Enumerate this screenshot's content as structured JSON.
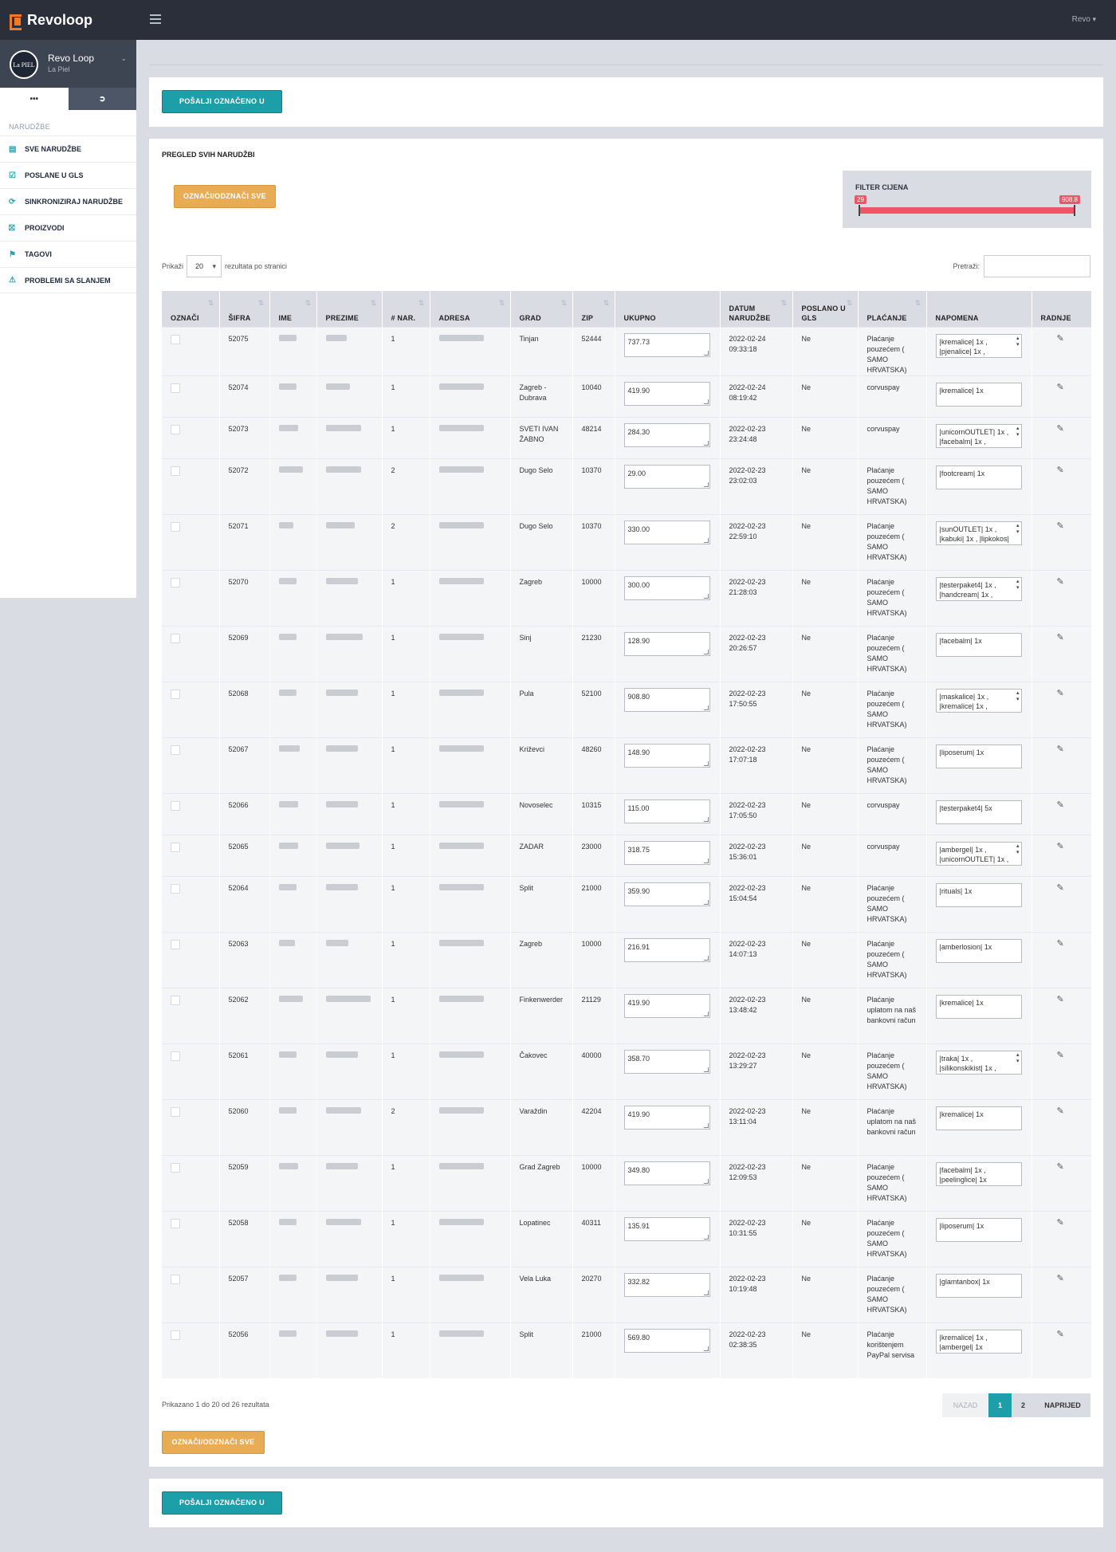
{
  "app": {
    "brand": "Revoloop",
    "user_menu": "Revo"
  },
  "profile": {
    "name": "Revo Loop",
    "subtitle": "La Piel",
    "avatar_text": "La PIEL",
    "tab_more": "•••",
    "tab_logout_icon": "logout-icon"
  },
  "nav": {
    "header": "NARUDŽBE",
    "items": [
      {
        "label": "SVE NARUDŽBE",
        "icon": "list-icon"
      },
      {
        "label": "POSLANE U GLS",
        "icon": "check-square-icon"
      },
      {
        "label": "SINKRONIZIRAJ NARUDŽBE",
        "icon": "sync-icon"
      },
      {
        "label": "PROIZVODI",
        "icon": "cart-icon"
      },
      {
        "label": "TAGOVI",
        "icon": "bookmark-icon"
      },
      {
        "label": "PROBLEMI SA SLANJEM",
        "icon": "warning-icon"
      }
    ]
  },
  "actions": {
    "send_gls": "POŠALJI OZNAČENO U GLS",
    "toggle_all": "OZNAČI/ODZNAČI SVE"
  },
  "orders_panel": {
    "title": "PREGLED SVIH NARUDŽBI",
    "filter_label": "FILTER CIJENA",
    "filter_min": "29",
    "filter_max": "908.8",
    "show_label_before": "Prikaži",
    "page_size": "20",
    "show_label_after": "rezultata po stranici",
    "search_label": "Pretraži:",
    "search_value": "",
    "columns": [
      "OZNAČI",
      "ŠIFRA",
      "IME",
      "PREZIME",
      "# NAR.",
      "ADRESA",
      "GRAD",
      "ZIP",
      "UKUPNO",
      "DATUM NARUDŽBE",
      "POSLANO U GLS",
      "PLAĆANJE",
      "NAPOMENA",
      "RADNJE"
    ],
    "rows": [
      {
        "sifra": "52075",
        "nar": "1",
        "grad": "Tinjan",
        "zip": "52444",
        "ukupno": "737.73",
        "datum": "2022-02-24 09:33:18",
        "poslano": "Ne",
        "placanje": "Plaćanje pouzećem ( SAMO HRVATSKA)",
        "napomena": "|kremalice| 1x ,\n|pjenalice| 1x ,",
        "scroll": true,
        "h": 56
      },
      {
        "sifra": "52074",
        "nar": "1",
        "grad": "Zagreb - Dubrava",
        "zip": "10040",
        "ukupno": "419.90",
        "datum": "2022-02-24 08:19:42",
        "poslano": "Ne",
        "placanje": "corvuspay",
        "napomena": "|kremalice| 1x",
        "scroll": false,
        "h": 52
      },
      {
        "sifra": "52073",
        "nar": "1",
        "grad": "SVETI IVAN ŽABNO",
        "zip": "48214",
        "ukupno": "284.30",
        "datum": "2022-02-23 23:24:48",
        "poslano": "Ne",
        "placanje": "corvuspay",
        "napomena": "|unicornOUTLET| 1x ,\n|facebalm| 1x ,",
        "scroll": true,
        "h": 52
      },
      {
        "sifra": "52072",
        "nar": "2",
        "grad": "Dugo Selo",
        "zip": "10370",
        "ukupno": "29.00",
        "datum": "2022-02-23 23:02:03",
        "poslano": "Ne",
        "placanje": "Plaćanje pouzećem ( SAMO HRVATSKA)",
        "napomena": "|footcream| 1x",
        "scroll": false,
        "h": 70
      },
      {
        "sifra": "52071",
        "nar": "2",
        "grad": "Dugo Selo",
        "zip": "10370",
        "ukupno": "330.00",
        "datum": "2022-02-23 22:59:10",
        "poslano": "Ne",
        "placanje": "Plaćanje pouzećem ( SAMO HRVATSKA)",
        "napomena": "|sunOUTLET| 1x ,\n|kabuki| 1x , |lipkokos|",
        "scroll": true,
        "h": 70
      },
      {
        "sifra": "52070",
        "nar": "1",
        "grad": "Zagreb",
        "zip": "10000",
        "ukupno": "300.00",
        "datum": "2022-02-23 21:28:03",
        "poslano": "Ne",
        "placanje": "Plaćanje pouzećem ( SAMO HRVATSKA)",
        "napomena": "|testerpaket4| 1x ,\n|handcream| 1x ,",
        "scroll": true,
        "h": 70
      },
      {
        "sifra": "52069",
        "nar": "1",
        "grad": "Sinj",
        "zip": "21230",
        "ukupno": "128.90",
        "datum": "2022-02-23 20:26:57",
        "poslano": "Ne",
        "placanje": "Plaćanje pouzećem ( SAMO HRVATSKA)",
        "napomena": "|facebalm| 1x",
        "scroll": false,
        "h": 70
      },
      {
        "sifra": "52068",
        "nar": "1",
        "grad": "Pula",
        "zip": "52100",
        "ukupno": "908.80",
        "datum": "2022-02-23 17:50:55",
        "poslano": "Ne",
        "placanje": "Plaćanje pouzećem ( SAMO HRVATSKA)",
        "napomena": "|maskalice| 1x ,\n|kremalice| 1x ,",
        "scroll": true,
        "h": 70
      },
      {
        "sifra": "52067",
        "nar": "1",
        "grad": "Križevci",
        "zip": "48260",
        "ukupno": "148.90",
        "datum": "2022-02-23 17:07:18",
        "poslano": "Ne",
        "placanje": "Plaćanje pouzećem ( SAMO HRVATSKA)",
        "napomena": "|liposerum| 1x",
        "scroll": false,
        "h": 70
      },
      {
        "sifra": "52066",
        "nar": "1",
        "grad": "Novoselec",
        "zip": "10315",
        "ukupno": "115.00",
        "datum": "2022-02-23 17:05:50",
        "poslano": "Ne",
        "placanje": "corvuspay",
        "napomena": "|testerpaket4| 5x",
        "scroll": false,
        "h": 52
      },
      {
        "sifra": "52065",
        "nar": "1",
        "grad": "ZADAR",
        "zip": "23000",
        "ukupno": "318.75",
        "datum": "2022-02-23 15:36:01",
        "poslano": "Ne",
        "placanje": "corvuspay",
        "napomena": "|ambergel| 1x ,\n|unicornOUTLET| 1x ,",
        "scroll": true,
        "h": 52
      },
      {
        "sifra": "52064",
        "nar": "1",
        "grad": "Split",
        "zip": "21000",
        "ukupno": "359.90",
        "datum": "2022-02-23 15:04:54",
        "poslano": "Ne",
        "placanje": "Plaćanje pouzećem ( SAMO HRVATSKA)",
        "napomena": "|rituals| 1x",
        "scroll": false,
        "h": 70
      },
      {
        "sifra": "52063",
        "nar": "1",
        "grad": "Zagreb",
        "zip": "10000",
        "ukupno": "216.91",
        "datum": "2022-02-23 14:07:13",
        "poslano": "Ne",
        "placanje": "Plaćanje pouzećem ( SAMO HRVATSKA)",
        "napomena": "|amberlosion| 1x",
        "scroll": false,
        "h": 70
      },
      {
        "sifra": "52062",
        "nar": "1",
        "grad": "Finkenwerder",
        "zip": "21129",
        "ukupno": "419.90",
        "datum": "2022-02-23 13:48:42",
        "poslano": "Ne",
        "placanje": "Plaćanje uplatom na naš bankovni račun",
        "napomena": "|kremalice| 1x",
        "scroll": false,
        "h": 70
      },
      {
        "sifra": "52061",
        "nar": "1",
        "grad": "Čakovec",
        "zip": "40000",
        "ukupno": "358.70",
        "datum": "2022-02-23 13:29:27",
        "poslano": "Ne",
        "placanje": "Plaćanje pouzećem ( SAMO HRVATSKA)",
        "napomena": "|traka| 1x ,\n|silikonskikist| 1x ,",
        "scroll": true,
        "h": 70
      },
      {
        "sifra": "52060",
        "nar": "2",
        "grad": "Varaždin",
        "zip": "42204",
        "ukupno": "419.90",
        "datum": "2022-02-23 13:11:04",
        "poslano": "Ne",
        "placanje": "Plaćanje uplatom na naš bankovni račun",
        "napomena": "|kremalice| 1x",
        "scroll": false,
        "h": 70
      },
      {
        "sifra": "52059",
        "nar": "1",
        "grad": "Grad Zagreb",
        "zip": "10000",
        "ukupno": "349.80",
        "datum": "2022-02-23 12:09:53",
        "poslano": "Ne",
        "placanje": "Plaćanje pouzećem ( SAMO HRVATSKA)",
        "napomena": "|facebalm| 1x ,\n|peelinglice| 1x",
        "scroll": false,
        "h": 70
      },
      {
        "sifra": "52058",
        "nar": "1",
        "grad": "Lopatinec",
        "zip": "40311",
        "ukupno": "135.91",
        "datum": "2022-02-23 10:31:55",
        "poslano": "Ne",
        "placanje": "Plaćanje pouzećem ( SAMO HRVATSKA)",
        "napomena": "|liposerum| 1x",
        "scroll": false,
        "h": 70
      },
      {
        "sifra": "52057",
        "nar": "1",
        "grad": "Vela Luka",
        "zip": "20270",
        "ukupno": "332.82",
        "datum": "2022-02-23 10:19:48",
        "poslano": "Ne",
        "placanje": "Plaćanje pouzećem ( SAMO HRVATSKA)",
        "napomena": "|glamtanbox| 1x",
        "scroll": false,
        "h": 70
      },
      {
        "sifra": "52056",
        "nar": "1",
        "grad": "Split",
        "zip": "21000",
        "ukupno": "569.80",
        "datum": "2022-02-23 02:38:35",
        "poslano": "Ne",
        "placanje": "Plaćanje korištenjem PayPal servisa",
        "napomena": "|kremalice| 1x ,\n|ambergel| 1x",
        "scroll": false,
        "h": 70
      }
    ],
    "info": "Prikazano 1 do 20 od 26 rezultata",
    "pager": {
      "prev": "NAZAD",
      "pages": [
        "1",
        "2"
      ],
      "active": "1",
      "next": "NAPRIJED"
    }
  }
}
